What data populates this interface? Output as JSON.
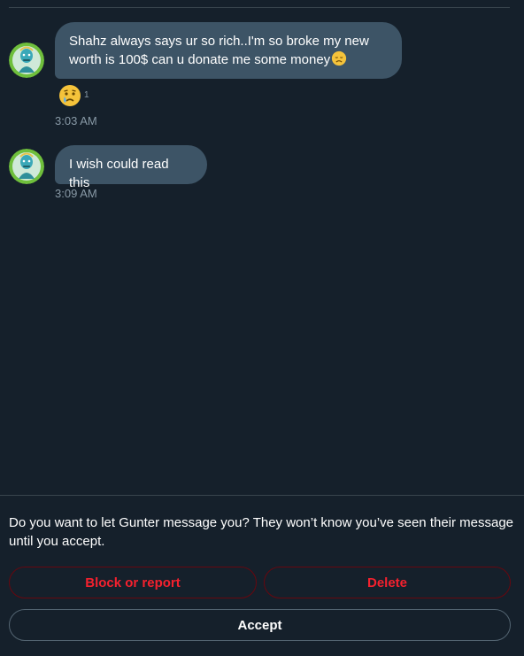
{
  "messages": [
    {
      "sender": "Gunter",
      "text": "Shahz always says ur so rich..I'm so broke my new worth is 100$ can u donate me some money",
      "inline_emoji": "disappointed-face",
      "reaction": {
        "emoji": "crying-face",
        "count": "1"
      },
      "time": "3:03 AM"
    },
    {
      "sender": "Gunter",
      "text": "I wish could read this",
      "time": "3:09 AM"
    }
  ],
  "request": {
    "prompt": "Do you want to let Gunter message you? They won’t know you’ve seen their message until you accept.",
    "block_label": "Block or report",
    "delete_label": "Delete",
    "accept_label": "Accept"
  },
  "colors": {
    "background": "#15202b",
    "bubble": "#3d5466",
    "danger": "#f4212e",
    "muted": "#8899a6",
    "divider": "#38444d"
  }
}
